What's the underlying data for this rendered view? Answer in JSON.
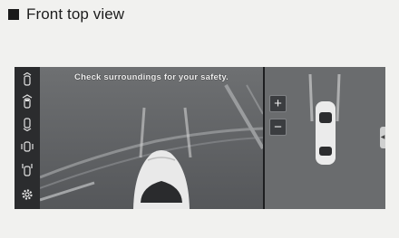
{
  "section": {
    "title": "Front top view"
  },
  "camera": {
    "message": "Check surroundings for your safety.",
    "sidebar": {
      "items": [
        {
          "icon": "front-view-icon"
        },
        {
          "icon": "front-top-view-icon"
        },
        {
          "icon": "rear-view-icon"
        },
        {
          "icon": "side-view-icon"
        },
        {
          "icon": "parking-guide-icon"
        },
        {
          "icon": "settings-gear-icon"
        }
      ]
    },
    "zoom": {
      "in_label": "+",
      "out_label": "−"
    }
  }
}
